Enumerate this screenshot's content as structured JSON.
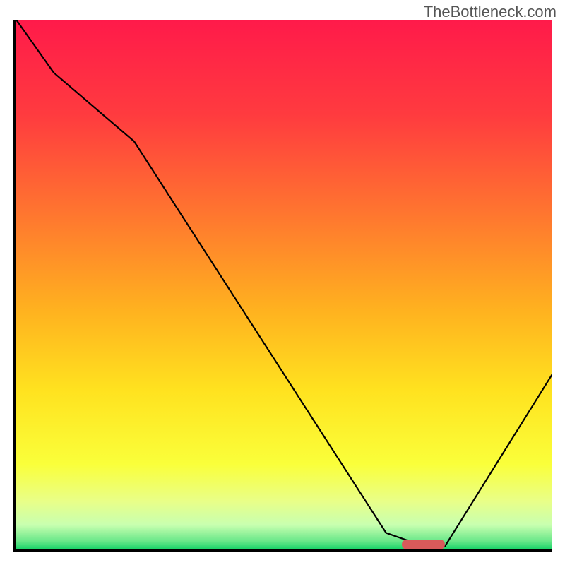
{
  "watermark": "TheBottleneck.com",
  "chart_data": {
    "type": "line",
    "title": "",
    "xlabel": "",
    "ylabel": "",
    "xlim": [
      0,
      100
    ],
    "ylim": [
      0,
      100
    ],
    "grid": false,
    "legend": false,
    "gradient_stops": [
      {
        "offset": 0.0,
        "color": "#ff1a4a"
      },
      {
        "offset": 0.18,
        "color": "#ff3b3f"
      },
      {
        "offset": 0.38,
        "color": "#ff7a2e"
      },
      {
        "offset": 0.55,
        "color": "#ffb21f"
      },
      {
        "offset": 0.7,
        "color": "#ffe21f"
      },
      {
        "offset": 0.84,
        "color": "#faff3a"
      },
      {
        "offset": 0.91,
        "color": "#e9ff88"
      },
      {
        "offset": 0.955,
        "color": "#c8ffb0"
      },
      {
        "offset": 0.985,
        "color": "#6be88a"
      },
      {
        "offset": 1.0,
        "color": "#1cd46a"
      }
    ],
    "series": [
      {
        "name": "bottleneck-curve",
        "x": [
          0,
          7,
          22,
          69,
          76,
          80,
          100
        ],
        "y": [
          100,
          90,
          77,
          3,
          0.5,
          0.5,
          33
        ]
      }
    ],
    "marker": {
      "name": "optimal-range",
      "x_start": 72,
      "x_end": 80,
      "y": 0.8,
      "color": "#d85a5a"
    }
  }
}
